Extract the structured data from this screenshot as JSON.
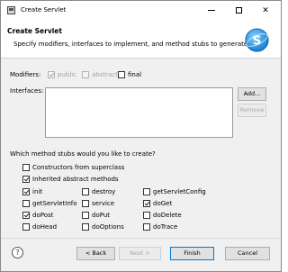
{
  "window": {
    "title": "Create Servlet",
    "min_icon": "minimize-icon",
    "max_icon": "maximize-icon",
    "close_glyph": "✕"
  },
  "banner": {
    "title": "Create Servlet",
    "description": "Specify modifiers, interfaces to implement, and method stubs to generate.",
    "logo_icon": "servlet-logo-icon",
    "logo_letter": "S"
  },
  "modifiers": {
    "label": "Modifiers:",
    "public": {
      "label": "public",
      "checked": true,
      "enabled": false
    },
    "abstract": {
      "label": "abstract",
      "checked": false,
      "enabled": false
    },
    "final": {
      "label": "final",
      "checked": false,
      "enabled": true
    }
  },
  "interfaces": {
    "label": "Interfaces:",
    "items": [],
    "add_label": "Add...",
    "remove_label": "Remove"
  },
  "stubs": {
    "question": "Which method stubs would you like to create?",
    "constructors": {
      "label": "Constructors from superclass",
      "checked": false
    },
    "inherited": {
      "label": "Inherited abstract methods",
      "checked": true
    },
    "methods": [
      {
        "label": "init",
        "checked": true
      },
      {
        "label": "destroy",
        "checked": false
      },
      {
        "label": "getServletConfig",
        "checked": false
      },
      {
        "label": "getServletInfo",
        "checked": false
      },
      {
        "label": "service",
        "checked": false
      },
      {
        "label": "doGet",
        "checked": true
      },
      {
        "label": "doPost",
        "checked": true
      },
      {
        "label": "doPut",
        "checked": false
      },
      {
        "label": "doDelete",
        "checked": false
      },
      {
        "label": "doHead",
        "checked": false
      },
      {
        "label": "doOptions",
        "checked": false
      },
      {
        "label": "doTrace",
        "checked": false
      }
    ]
  },
  "footer": {
    "help_glyph": "?",
    "back_label": "< Back",
    "next_label": "Next >",
    "finish_label": "Finish",
    "cancel_label": "Cancel"
  }
}
